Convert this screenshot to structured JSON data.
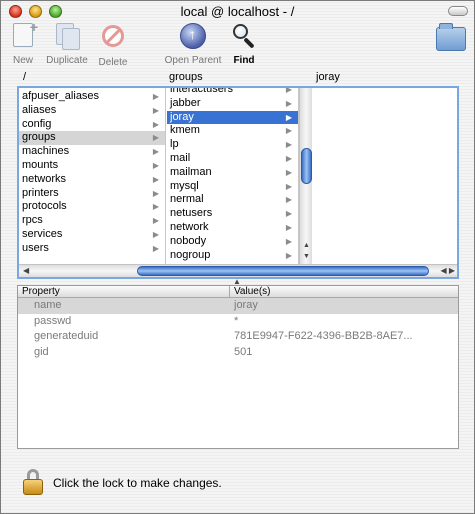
{
  "window": {
    "title": "local @ localhost - /"
  },
  "toolbar": {
    "new_label": "New",
    "duplicate_label": "Duplicate",
    "delete_label": "Delete",
    "open_parent_label": "Open Parent",
    "find_label": "Find"
  },
  "columns": {
    "col1_header": "/",
    "col2_header": "groups",
    "col3_header": "joray",
    "col1_items": [
      "afpuser_aliases",
      "aliases",
      "config",
      "groups",
      "machines",
      "mounts",
      "networks",
      "printers",
      "protocols",
      "rpcs",
      "services",
      "users"
    ],
    "col1_selected": "groups",
    "col2_items": [
      "interactusers",
      "jabber",
      "joray",
      "kmem",
      "lp",
      "mail",
      "mailman",
      "mysql",
      "nermal",
      "netusers",
      "network",
      "nobody",
      "nogroup"
    ],
    "col2_selected": "joray"
  },
  "properties": {
    "header_property": "Property",
    "header_value": "Value(s)",
    "rows": [
      {
        "name": "name",
        "value": "joray"
      },
      {
        "name": "passwd",
        "value": "*"
      },
      {
        "name": "generateduid",
        "value": "781E9947-F622-4396-BB2B-8AE7..."
      },
      {
        "name": "gid",
        "value": "501"
      }
    ]
  },
  "lock": {
    "text": "Click the lock to make changes."
  },
  "colors": {
    "selection_blue": "#3873d3",
    "scroll_blue": "#3b6fc5"
  }
}
